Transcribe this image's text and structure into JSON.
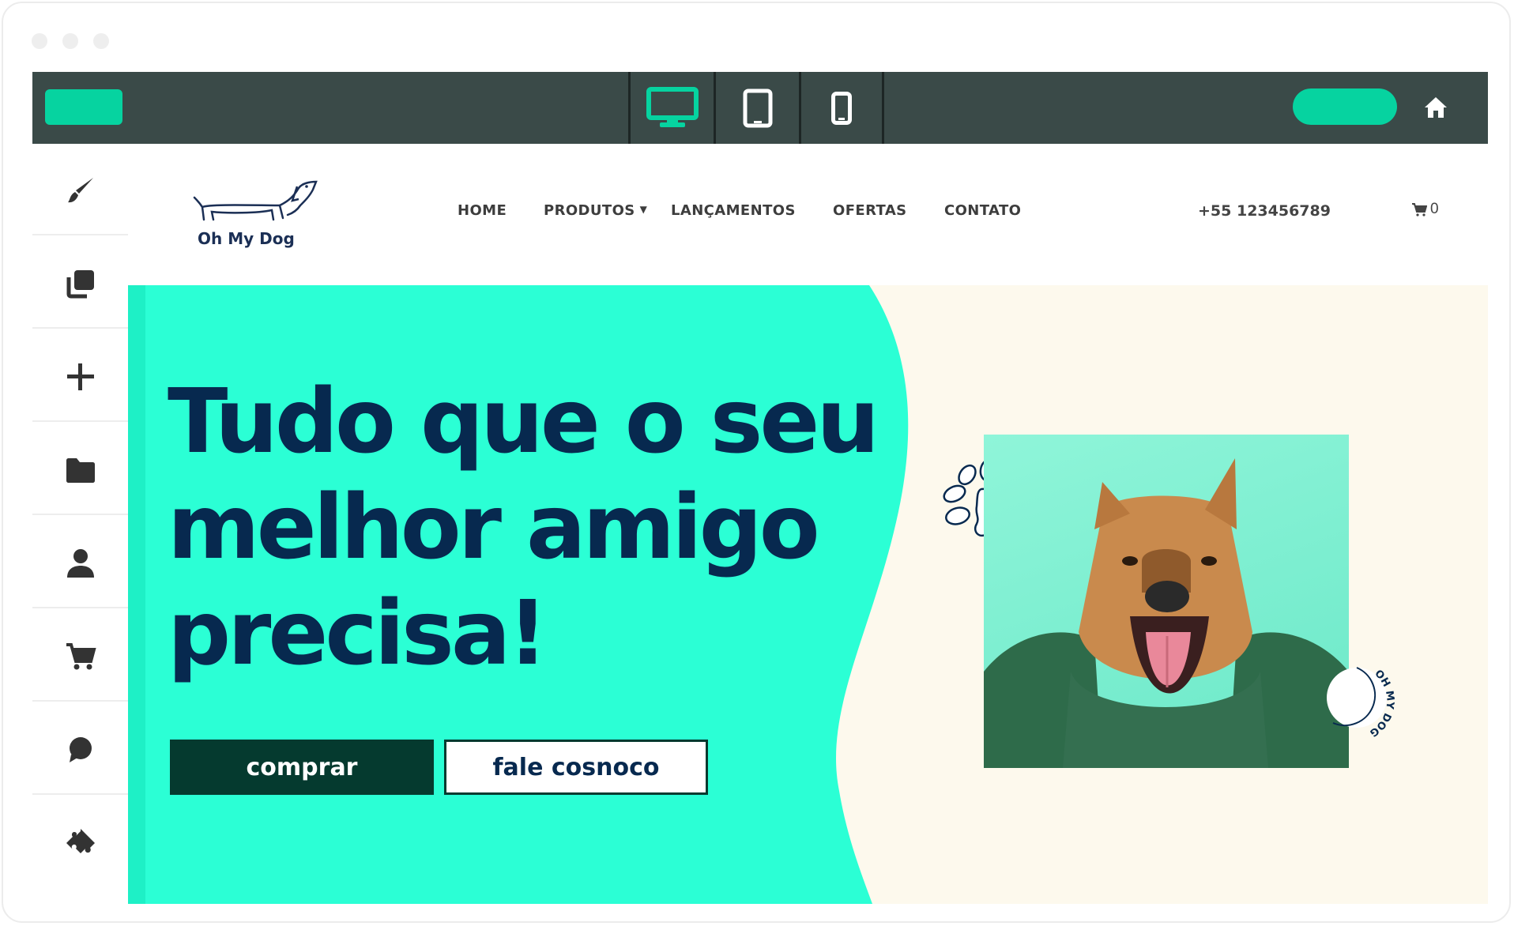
{
  "toolbar": {
    "devices": [
      {
        "icon": "desktop-icon",
        "active": true
      },
      {
        "icon": "tablet-icon",
        "active": false
      },
      {
        "icon": "mobile-icon",
        "active": false
      }
    ],
    "accent_color": "#06d3a0",
    "home_icon": "home-icon"
  },
  "sidebar": {
    "items": [
      {
        "icon": "brush-icon"
      },
      {
        "icon": "pages-icon"
      },
      {
        "icon": "add-icon"
      },
      {
        "icon": "folder-icon"
      },
      {
        "icon": "user-icon"
      },
      {
        "icon": "cart-icon"
      },
      {
        "icon": "chat-icon"
      },
      {
        "icon": "puzzle-icon"
      }
    ]
  },
  "site": {
    "logo_text": "Oh My Dog",
    "nav": {
      "home": "HOME",
      "produtos": "PRODUTOS",
      "lancamentos": "LANÇAMENTOS",
      "ofertas": "OFERTAS",
      "contato": "CONTATO"
    },
    "phone": "+55 123456789",
    "cart_count": "0",
    "hero": {
      "headline_line1": "Tudo que o seu",
      "headline_line2": "melhor amigo",
      "headline_line3": "precisa!",
      "buy_label": "comprar",
      "contact_label": "fale cosnoco",
      "badge_text": "OH MY DOG",
      "hero_color": "#2bffd5",
      "headline_color": "#07294f"
    }
  }
}
